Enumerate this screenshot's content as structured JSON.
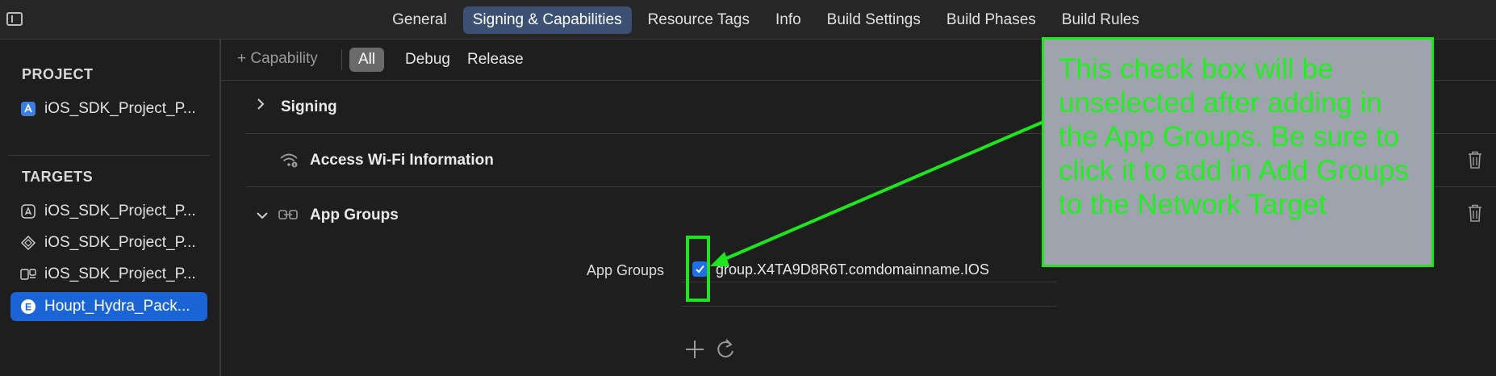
{
  "tabs": [
    "General",
    "Signing & Capabilities",
    "Resource Tags",
    "Info",
    "Build Settings",
    "Build Phases",
    "Build Rules"
  ],
  "active_tab": 1,
  "sidebar": {
    "project_heading": "PROJECT",
    "project_item": "iOS_SDK_Project_P...",
    "targets_heading": "TARGETS",
    "targets": [
      "iOS_SDK_Project_P...",
      "iOS_SDK_Project_P...",
      "iOS_SDK_Project_P...",
      "Houpt_Hydra_Pack..."
    ],
    "selected_target": 3
  },
  "filterbar": {
    "capability": "+ Capability",
    "filters": [
      "All",
      "Debug",
      "Release"
    ],
    "active_filter": 0
  },
  "sections": {
    "signing": "Signing",
    "wifi": "Access Wi-Fi Information",
    "app_groups": "App Groups"
  },
  "app_groups_field": {
    "label": "App Groups",
    "checked": true,
    "value": "group.X4TA9D8R6T.comdomainname.IOS"
  },
  "annotation": {
    "text": "This check box will be unselected after adding in the App Groups. Be sure to click it to add in Add Groups to the Network Target",
    "color": "#1ee61e"
  },
  "colors": {
    "accent": "#1a64d6",
    "active_tab": "#3b5073"
  }
}
